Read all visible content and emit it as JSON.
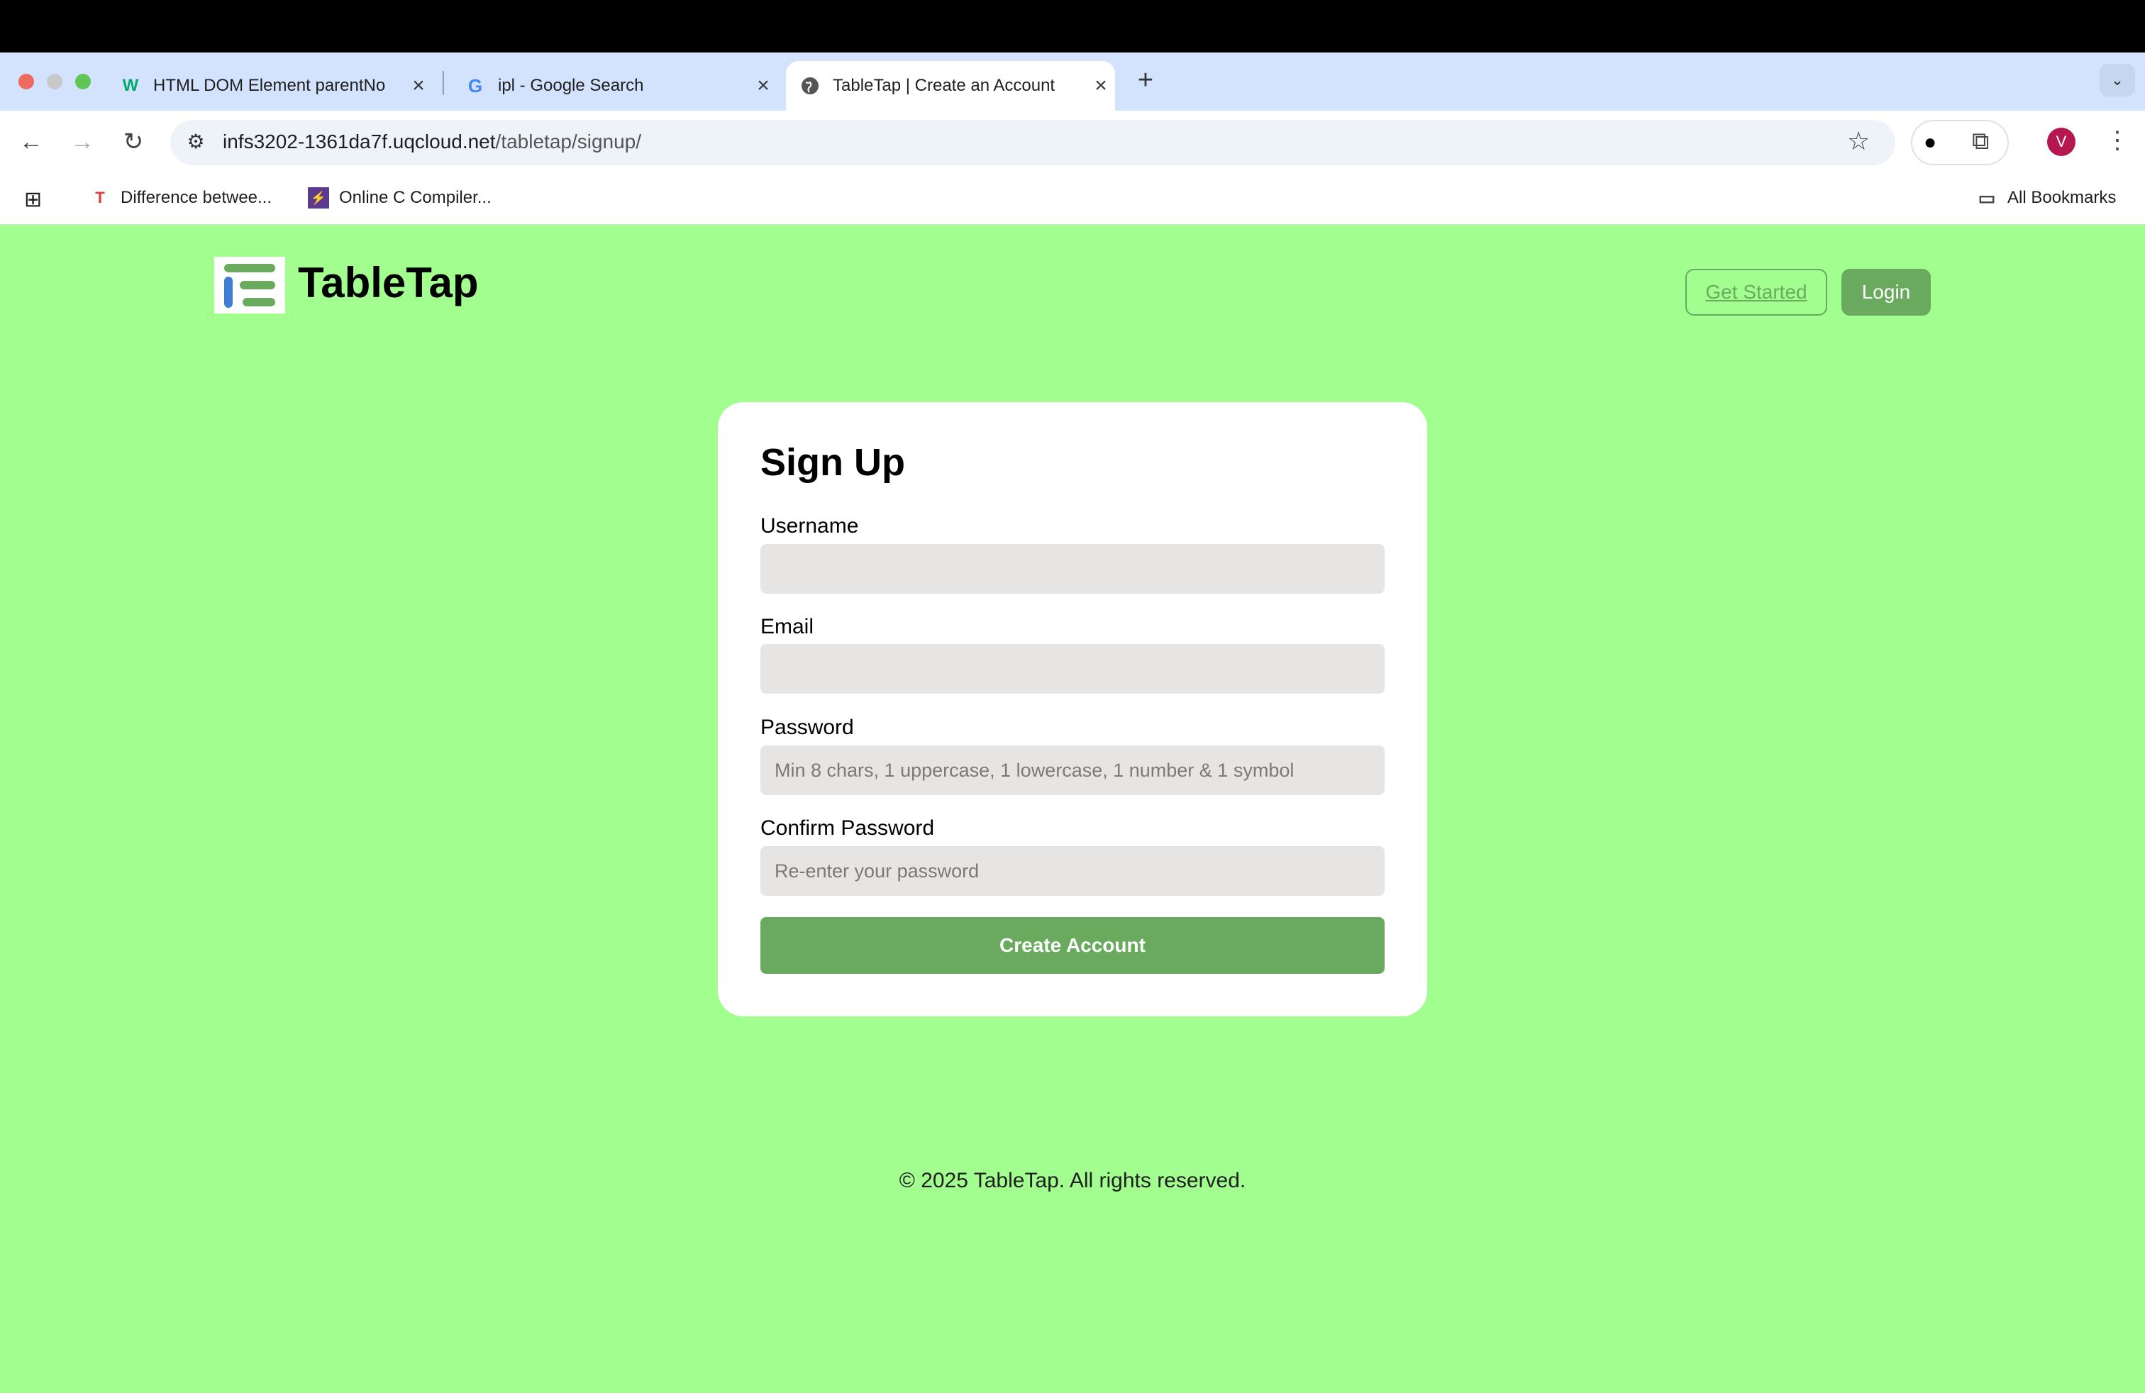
{
  "browser": {
    "tabs": [
      {
        "title": "HTML DOM Element parentNo",
        "favicon": "w3schools-icon",
        "active": false
      },
      {
        "title": "ipl - Google Search",
        "favicon": "google-icon",
        "active": false
      },
      {
        "title": "TableTap | Create an Account",
        "favicon": "globe-icon",
        "active": true
      }
    ],
    "url_host": "infs3202-1361da7f.uqcloud.net",
    "url_path": "/tabletap/signup/",
    "avatar_letter": "V",
    "bookmarks": [
      {
        "label": "Difference betwee...",
        "icon": "t-logo-icon"
      },
      {
        "label": "Online C Compiler...",
        "icon": "lightning-icon"
      }
    ],
    "all_bookmarks": "All Bookmarks"
  },
  "site": {
    "brand": "TableTap",
    "nav": {
      "get_started": "Get Started",
      "login": "Login"
    }
  },
  "form": {
    "title": "Sign Up",
    "username_label": "Username",
    "username_value": "",
    "email_label": "Email",
    "email_value": "",
    "password_label": "Password",
    "password_placeholder": "Min 8 chars, 1 uppercase, 1 lowercase, 1 number & 1 symbol",
    "confirm_label": "Confirm Password",
    "confirm_placeholder": "Re-enter your password",
    "submit": "Create Account"
  },
  "footer": "© 2025 TableTap. All rights reserved.",
  "colors": {
    "page_bg": "#a1fe8f",
    "accent": "#6aaa5e"
  }
}
